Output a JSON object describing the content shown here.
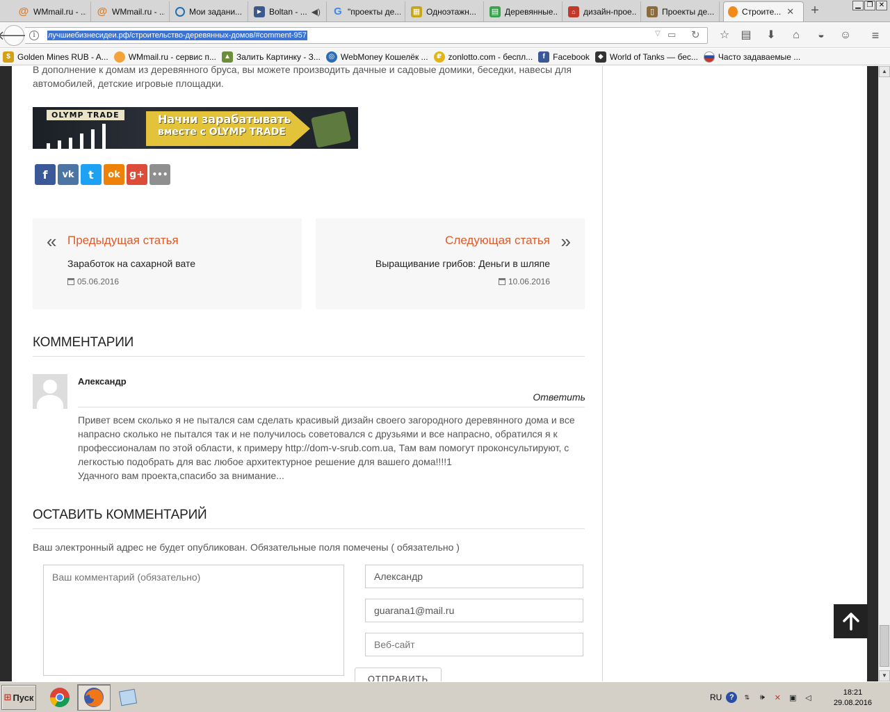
{
  "browser": {
    "tabs": [
      {
        "title": "WMmail.ru - ...",
        "icon": "at-icon",
        "color": "#e07b1a"
      },
      {
        "title": "WMmail.ru - ...",
        "icon": "at-icon",
        "color": "#e07b1a"
      },
      {
        "title": "Мои задани...",
        "icon": "target-icon",
        "color": "#1f6fb5"
      },
      {
        "title": "Boltan - ...",
        "icon": "video-icon",
        "color": "#3b5a8c"
      },
      {
        "title": "\"проекты де...",
        "icon": "google-icon",
        "color": "#4285f4"
      },
      {
        "title": "Одноэтажн...",
        "icon": "grid-icon",
        "color": "#c5a51a"
      },
      {
        "title": "Деревянные...",
        "icon": "doc-icon",
        "color": "#3aa24a"
      },
      {
        "title": "дизайн-прое...",
        "icon": "house-icon",
        "color": "#c0392b"
      },
      {
        "title": "Проекты де...",
        "icon": "book-icon",
        "color": "#8b6a3e"
      },
      {
        "title": "Строите...",
        "icon": "lightbulb-icon",
        "color": "#f28a1a",
        "active": true
      }
    ],
    "new_tab": "+",
    "close_tab": "✕",
    "url": "лучшиебизнесидеи.рф/строительство-деревянных-домов/#comment-957",
    "bookmarks": [
      {
        "label": "Golden Mines RUB - A...",
        "icon": "coin-icon",
        "color": "#d4a017"
      },
      {
        "label": "WMmail.ru - сервис п...",
        "icon": "envelope-icon",
        "color": "#f2a33a"
      },
      {
        "label": "Залить Картинку - З...",
        "icon": "image-icon",
        "color": "#6a8e3a"
      },
      {
        "label": "WebMoney Кошелёк ...",
        "icon": "globe-icon",
        "color": "#2a6db5"
      },
      {
        "label": "zonlotto.com - беспл...",
        "icon": "ruble-icon",
        "color": "#e2b414"
      },
      {
        "label": "Facebook",
        "icon": "facebook-icon",
        "color": "#3b5998"
      },
      {
        "label": "World of Tanks — бес...",
        "icon": "shield-icon",
        "color": "#333"
      },
      {
        "label": "Часто задаваемые ...",
        "icon": "flag-ru-icon",
        "color": "#c0392b"
      }
    ]
  },
  "article": {
    "intro": "В дополнение к домам из деревянного бруса, вы можете производить дачные и садовые домики, беседки, навесы для автомобилей, детские игровые площадки.",
    "banner": {
      "logo": "OLYMP TRADE",
      "line1": "Начни зарабатывать",
      "line2": "вместе с OLYMP TRADE",
      "accent": "#e2c33a"
    },
    "share": [
      {
        "name": "facebook",
        "glyph": "f",
        "color": "#3b5998"
      },
      {
        "name": "vkontakte",
        "glyph": "vk",
        "color": "#4c75a3"
      },
      {
        "name": "twitter",
        "glyph": "t",
        "color": "#1da1f2"
      },
      {
        "name": "odnoklassniki",
        "glyph": "ok",
        "color": "#ee8208"
      },
      {
        "name": "googleplus",
        "glyph": "g+",
        "color": "#dd4b39"
      },
      {
        "name": "more",
        "glyph": "•••",
        "color": "#8f8f8f"
      }
    ],
    "prev": {
      "label": "Предыдущая статья",
      "title": "Заработок на сахарной вате",
      "date": "05.06.2016"
    },
    "next": {
      "label": "Следующая статья",
      "title": "Выращивание грибов: Деньги в шляпе",
      "date": "10.06.2016"
    },
    "accent": "#e05a2a"
  },
  "comments": {
    "heading": "КОММЕНТАРИИ",
    "items": [
      {
        "author": "Александр",
        "reply": "Ответить",
        "text": [
          "Привет всем сколько я не пытался сам сделать красивый дизайн своего загородного деревянного дома и все напрасно сколько не пытался так и не получилось советовался с друзьями и все напрасно, обратился я к профессионалам по этой области, к примеру http://dom-v-srub.com.ua, Там вам помогут проконсультируют, с легкостью подобрать для вас любое архитектурное решение для вашего дома!!!!1",
          "Удачного вам проекта,спасибо за внимание..."
        ]
      }
    ]
  },
  "reply_form": {
    "heading": "ОСТАВИТЬ КОММЕНТАРИЙ",
    "notes": "Ваш электронный адрес не будет опубликован. Обязательные поля помечены ( обязательно )",
    "comment_placeholder": "Ваш комментарий (обязательно)",
    "name_value": "Александр",
    "email_value": "guarana1@mail.ru",
    "website_placeholder": "Веб-сайт",
    "submit": "ОТПРАВИТЬ"
  },
  "taskbar": {
    "start": "Пуск",
    "lang": "RU",
    "time": "18:21",
    "date": "29.08.2016"
  }
}
